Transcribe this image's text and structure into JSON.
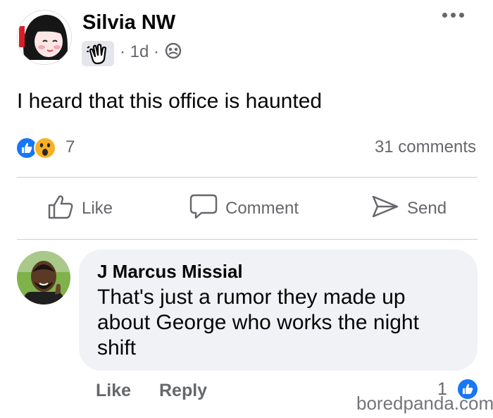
{
  "post": {
    "author": "Silvia NW",
    "time": "1d",
    "separator": "·",
    "text": "I heard  that this office is haunted",
    "reaction_count": "7",
    "comments_count": "31 comments",
    "audience_icon": "wave-hand-icon",
    "privacy_icon": "friends-icon"
  },
  "actions": {
    "like": "Like",
    "comment": "Comment",
    "send": "Send"
  },
  "comment": {
    "author": "J Marcus Missial",
    "text": "That's just a rumor they made up about George who works the night shift",
    "like": "Like",
    "reply": "Reply",
    "like_count": "1"
  },
  "watermark": "boredpanda.com",
  "colors": {
    "like_blue": "#1877f2",
    "secondary_text": "#65676b",
    "bubble_bg": "#f0f2f5",
    "divider": "#ced0d4"
  }
}
